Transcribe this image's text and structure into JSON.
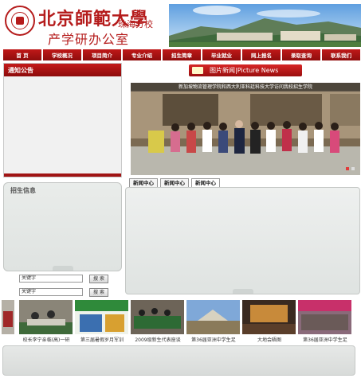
{
  "header": {
    "school_name": "北京師範大學",
    "branch": "珠海分校",
    "office": "产学研办公室"
  },
  "nav": {
    "items": [
      "首 页",
      "学校概况",
      "项目简介",
      "专业介绍",
      "招生简章",
      "毕业就业",
      "网上报名",
      "录取查询",
      "联系我们"
    ]
  },
  "notice": {
    "title": "通知公告"
  },
  "recruit": {
    "title": "招生信息"
  },
  "search": [
    {
      "value": "关键字",
      "button": "搜 索"
    },
    {
      "value": "关键字",
      "button": "搜 索"
    }
  ],
  "photo_news": {
    "title": "图片新闻|Picture News",
    "caption": "新加坡物流管理学院和西大利亚科廷科技大学访问我校招生学院"
  },
  "tabs": [
    "新闻中心",
    "新闻中心",
    "新闻中心"
  ],
  "gallery": {
    "captions": [
      "校长李宁亲临(高)一研",
      "第三届暑假岁月军训",
      "2009级新生代表座谈",
      "第36届亚洲中学生足",
      "大地会晤图",
      "第36届亚洲中学生足"
    ]
  },
  "colors": {
    "brand_red": "#b51c1c",
    "nav_red": "#a01212"
  }
}
